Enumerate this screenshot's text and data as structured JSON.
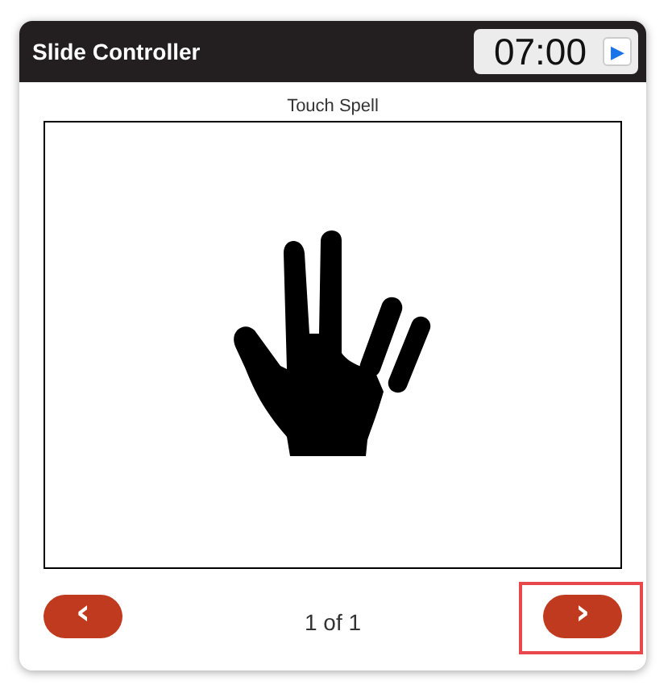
{
  "window": {
    "title": "Slide Controller"
  },
  "timer": {
    "time": "07:00",
    "play_button": {
      "icon": "▶"
    }
  },
  "slide": {
    "title": "Touch Spell",
    "kind": "hand"
  },
  "navigation": {
    "prev": {
      "icon": "‹",
      "highlighted": false
    },
    "position": "1 of 1",
    "next": {
      "icon": "›",
      "highlighted": true
    }
  }
}
